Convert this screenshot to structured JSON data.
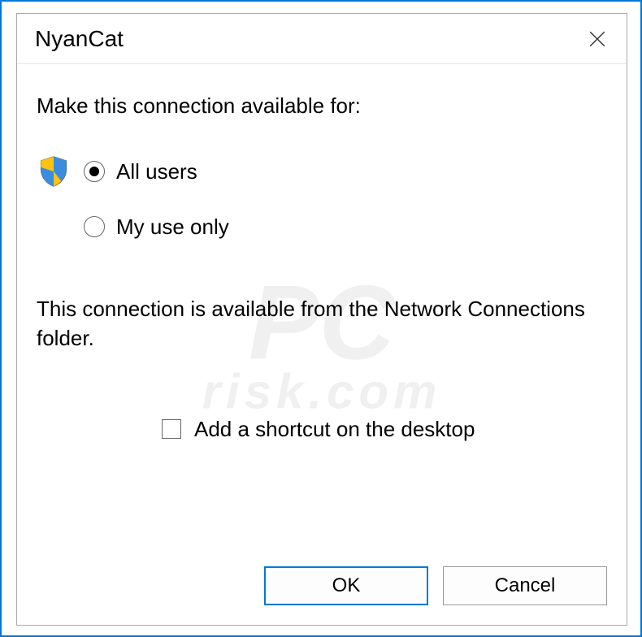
{
  "dialog": {
    "title": "NyanCat",
    "instruction": "Make this connection available for:",
    "options": {
      "all_users": "All users",
      "my_use_only": "My use only"
    },
    "selected_option": "all_users",
    "description": "This connection is available from the Network Connections folder.",
    "checkbox_label": "Add a shortcut on the desktop",
    "checkbox_checked": false,
    "buttons": {
      "ok": "OK",
      "cancel": "Cancel"
    }
  },
  "watermark": {
    "main": "PC",
    "sub": "risk.com"
  }
}
